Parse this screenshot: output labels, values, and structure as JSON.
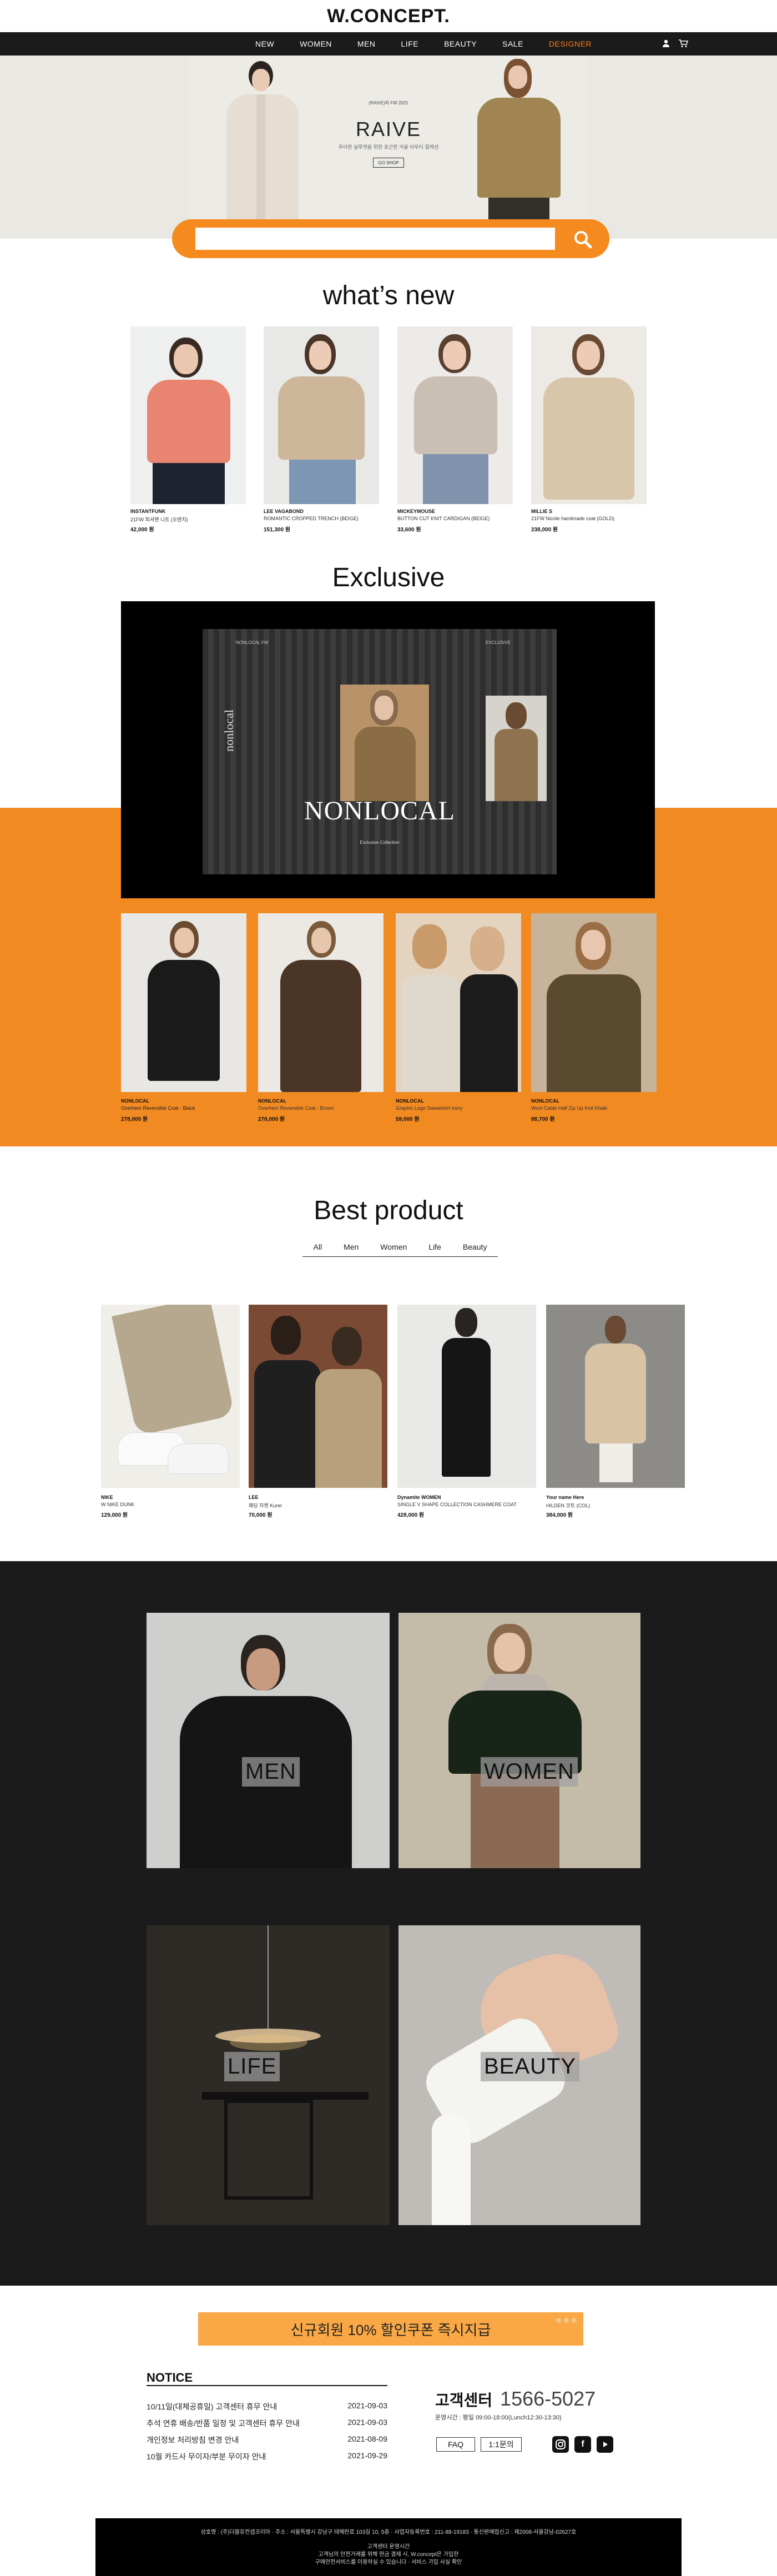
{
  "header": {
    "logo": "W.CONCEPT.",
    "nav": [
      "NEW",
      "WOMEN",
      "MEN",
      "LIFE",
      "BEAUTY",
      "SALE",
      "DESIGNER"
    ]
  },
  "hero": {
    "tagline": "(RAIVE)의 FW 2021",
    "brand": "RAIVE",
    "subtitle": "우아한 실루엣을 위한 포근한 겨울 아우터 컬렉션",
    "button": "GO SHOP"
  },
  "search": {
    "placeholder": ""
  },
  "whats_new": {
    "title": "what’s new",
    "products": [
      {
        "brand": "INSTANTFUNK",
        "name": "21FW 피셔맨 니트 (오렌지)",
        "price": "42,000 원"
      },
      {
        "brand": "LEE VAGABOND",
        "name": "ROMANTIC CROPPED TRENCH (BEIGE)",
        "price": "151,300 원"
      },
      {
        "brand": "MICKEYMOUSE",
        "name": "BUTTON CUT KNIT CARDIGAN (BEIGE)",
        "price": "33,600 원"
      },
      {
        "brand": "MILLIE S",
        "name": "21FW Nicole handmade coat (GOLD)",
        "price": "238,000 원"
      }
    ]
  },
  "exclusive": {
    "title": "Exclusive",
    "banner_brand": "NONLOCAL",
    "banner_side": "nonlocal",
    "banner_top_left": "NONLOCAL FW",
    "banner_top_right": "EXCLUSIVE",
    "banner_caption": "Exclusive Collection",
    "products": [
      {
        "brand": "NONLOCAL",
        "name": "Overhem Reversible Coat - Black",
        "price": "278,000 원"
      },
      {
        "brand": "NONLOCAL",
        "name": "Overhem Reversible Coat - Brown",
        "price": "278,000 원"
      },
      {
        "brand": "NONLOCAL",
        "name": "Graphic Logo Sweatshirt Ivory",
        "price": "59,000 원"
      },
      {
        "brand": "NONLOCAL",
        "name": "Wool Cable Half Zip Up Knit Khaki",
        "price": "88,700 원"
      }
    ]
  },
  "best": {
    "title": "Best product",
    "tabs": [
      "All",
      "Men",
      "Women",
      "Life",
      "Beauty"
    ],
    "products": [
      {
        "brand": "NIKE",
        "name": "W NIKE DUNK",
        "price": "129,000 원"
      },
      {
        "brand": "LEE",
        "name": "패딩 자켓 Kurer",
        "price": "70,000 원"
      },
      {
        "brand": "Dynamite WOMEN",
        "name": "SINGLE V SHAPE COLLECTION CASHMERE COAT",
        "price": "428,000 원"
      },
      {
        "brand": "Your name Here",
        "name": "HILDEN 코트 (COL)",
        "price": "384,000 원"
      }
    ]
  },
  "categories": {
    "men": "MEN",
    "women": "WOMEN",
    "life": "LIFE",
    "beauty": "BEAUTY"
  },
  "coupon": {
    "text": "신규회원 10% 할인쿠폰 즉시지급"
  },
  "notice": {
    "title": "NOTICE",
    "items": [
      {
        "text": "10/11일(대체공휴일) 고객센터 휴무 안내",
        "date": "2021-09-03"
      },
      {
        "text": "추석 연휴 배송/반품 일정 및 고객센터 휴무 안내",
        "date": "2021-09-03"
      },
      {
        "text": "개인정보 처리방침 변경 안내",
        "date": "2021-08-09"
      },
      {
        "text": "10월 카드사 무이자/부분 무이자 안내",
        "date": "2021-09-29"
      }
    ]
  },
  "cs": {
    "title": "고객센터",
    "phone": "1566-5027",
    "hours": "운영시간 : 평일 09:00-18:00(Lunch12:30-13:30)",
    "faq": "FAQ",
    "inquiry": "1:1문의"
  },
  "footer": {
    "line1": "상호명 : (주)더블유컨셉코리아 · 주소 : 서울특별시 강남구 테헤란로 103길 10, 5층 · 사업자등록번호 : 211-88-19183 · 통신판매업신고 : 제2008-서울강남-02627호",
    "line2": "고객센터 운영시간",
    "line3": "고객님의 안전거래를 위해 현금 결제 시, W.concept은 가입한",
    "line4": "구매안전서비스를 이용하실 수 있습니다 · 서비스 가입 사실 확인"
  },
  "colors": {
    "accent": "#f28a22",
    "dark": "#1b1b1b"
  }
}
